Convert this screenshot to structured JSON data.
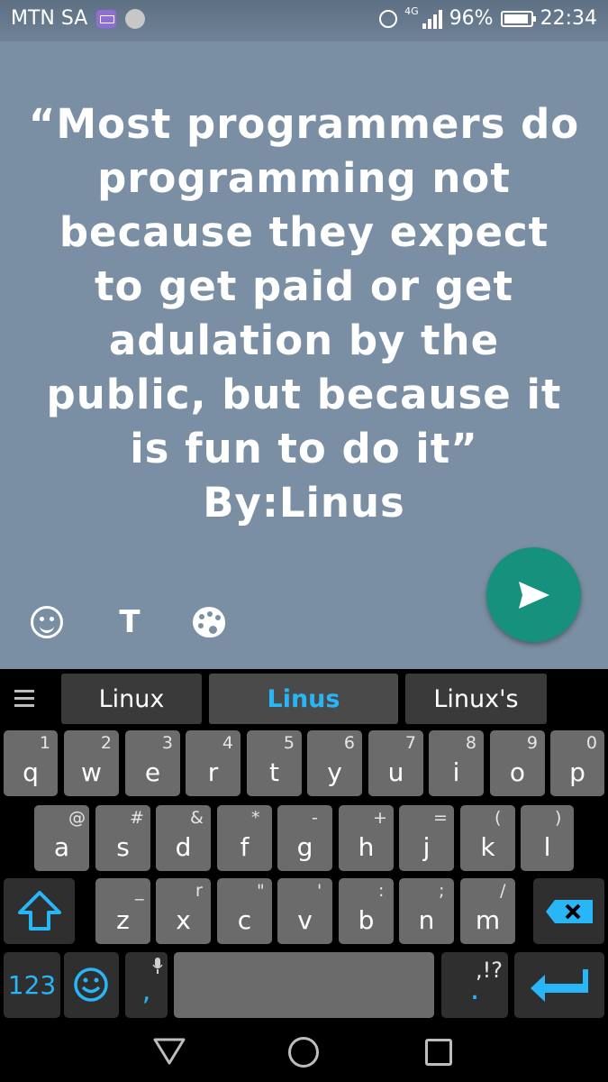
{
  "status_bar": {
    "carrier": "MTN SA",
    "network": "4G",
    "battery": "96%",
    "time": "22:34",
    "icons": [
      "keyboard-icon",
      "avatar-icon",
      "alarm-icon",
      "signal-icon",
      "battery-icon"
    ]
  },
  "status": {
    "quote_lines": [
      "“Most programmers do",
      "programming not",
      "because they expect",
      "to get paid or get",
      "adulation by the",
      "public, but because it",
      "is fun to do it”"
    ],
    "author": "By:Linus",
    "background_color": "#7a8fa3",
    "text_color": "#ffffff"
  },
  "tools": {
    "emoji_icon": "smiley-icon",
    "text_label": "T",
    "palette_icon": "palette-icon",
    "send_icon": "send-icon",
    "send_color": "#15917d"
  },
  "keyboard": {
    "suggestions": [
      "Linux",
      "Linus",
      "Linux's"
    ],
    "row1": [
      {
        "key": "q",
        "alt": "1"
      },
      {
        "key": "w",
        "alt": "2"
      },
      {
        "key": "e",
        "alt": "3"
      },
      {
        "key": "r",
        "alt": "4"
      },
      {
        "key": "t",
        "alt": "5"
      },
      {
        "key": "y",
        "alt": "6"
      },
      {
        "key": "u",
        "alt": "7"
      },
      {
        "key": "i",
        "alt": "8"
      },
      {
        "key": "o",
        "alt": "9"
      },
      {
        "key": "p",
        "alt": "0"
      }
    ],
    "row2": [
      {
        "key": "a",
        "alt": "@"
      },
      {
        "key": "s",
        "alt": "#"
      },
      {
        "key": "d",
        "alt": "&"
      },
      {
        "key": "f",
        "alt": "*"
      },
      {
        "key": "g",
        "alt": "-"
      },
      {
        "key": "h",
        "alt": "+"
      },
      {
        "key": "j",
        "alt": "="
      },
      {
        "key": "k",
        "alt": "("
      },
      {
        "key": "l",
        "alt": ")"
      }
    ],
    "row3": [
      {
        "key": "z",
        "alt": "_"
      },
      {
        "key": "x",
        "alt": "r"
      },
      {
        "key": "c",
        "alt": "\""
      },
      {
        "key": "v",
        "alt": "'"
      },
      {
        "key": "b",
        "alt": ":"
      },
      {
        "key": "n",
        "alt": ";"
      },
      {
        "key": "m",
        "alt": "/"
      }
    ],
    "numbers_label": "123",
    "comma_label": ",",
    "period_label": ".",
    "punct_label": ",!?",
    "accent_color": "#29b6f6"
  },
  "navbar": {
    "icons": [
      "back-icon",
      "home-icon",
      "recents-icon"
    ]
  }
}
